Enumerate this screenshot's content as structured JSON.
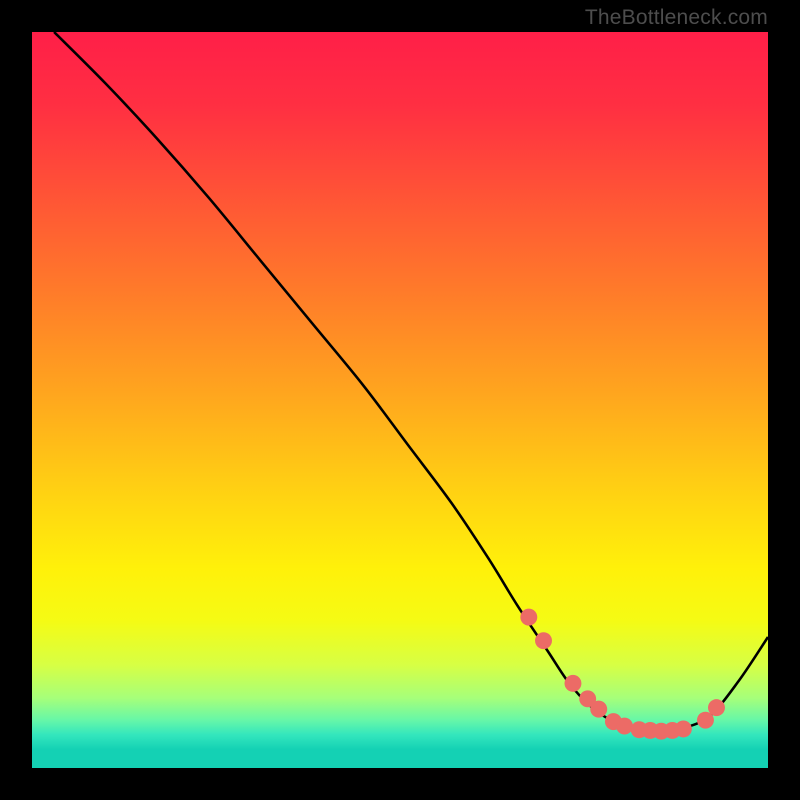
{
  "attribution": "TheBottleneck.com",
  "colors": {
    "frame": "#000000",
    "attribution": "#4d4d4d",
    "curve": "#000000",
    "dot_fill": "#ec6b66",
    "dot_stroke": "#ec6b66",
    "gradient_stops": [
      {
        "offset": 0.0,
        "color": "#ff1f48"
      },
      {
        "offset": 0.1,
        "color": "#ff2f42"
      },
      {
        "offset": 0.22,
        "color": "#ff5336"
      },
      {
        "offset": 0.35,
        "color": "#ff7a2a"
      },
      {
        "offset": 0.48,
        "color": "#ffa21f"
      },
      {
        "offset": 0.62,
        "color": "#ffd013"
      },
      {
        "offset": 0.73,
        "color": "#fff10a"
      },
      {
        "offset": 0.8,
        "color": "#f5fb14"
      },
      {
        "offset": 0.86,
        "color": "#d7ff44"
      },
      {
        "offset": 0.905,
        "color": "#a6ff7a"
      },
      {
        "offset": 0.935,
        "color": "#66f7a8"
      },
      {
        "offset": 0.955,
        "color": "#33e6bd"
      },
      {
        "offset": 0.975,
        "color": "#14d1b4"
      },
      {
        "offset": 1.0,
        "color": "#14d1b4"
      }
    ]
  },
  "chart_data": {
    "type": "line",
    "title": "",
    "xlabel": "",
    "ylabel": "",
    "xlim": [
      0,
      100
    ],
    "ylim": [
      0,
      100
    ],
    "series": [
      {
        "name": "bottleneck-curve",
        "x": [
          3,
          10,
          17,
          24,
          31,
          38,
          45,
          51,
          57,
          62,
          66,
          70,
          73,
          76,
          79,
          82,
          85,
          88,
          92,
          96,
          100
        ],
        "y": [
          100,
          93,
          85.5,
          77.5,
          69,
          60.5,
          52,
          44,
          36,
          28.5,
          22,
          16,
          11.5,
          8.3,
          6.3,
          5.2,
          5.0,
          5.3,
          7.0,
          11.8,
          17.8
        ]
      }
    ],
    "dots": {
      "name": "highlight-dots",
      "x": [
        67.5,
        69.5,
        73.5,
        75.5,
        77,
        79,
        80.5,
        82.5,
        84,
        85.5,
        87,
        88.5,
        91.5,
        93
      ],
      "y": [
        20.5,
        17.3,
        11.5,
        9.4,
        8.0,
        6.3,
        5.7,
        5.2,
        5.1,
        5.0,
        5.1,
        5.3,
        6.5,
        8.2
      ]
    }
  }
}
